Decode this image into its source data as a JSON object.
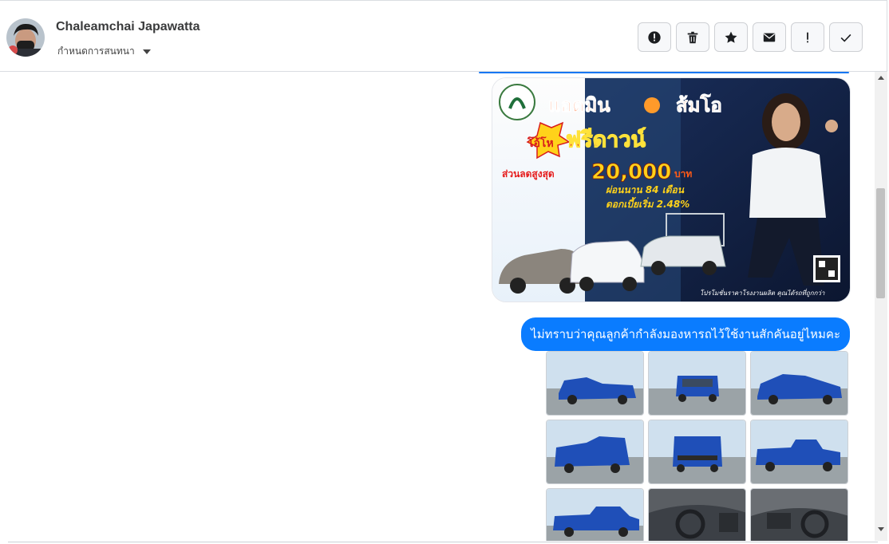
{
  "header": {
    "name": "Chaleamchai Japawatta",
    "subtitle": "กำหนดการสนทนา",
    "toolbar": [
      {
        "icon": "alert-circle-icon",
        "label": "Mark as spam"
      },
      {
        "icon": "trash-icon",
        "label": "Delete"
      },
      {
        "icon": "star-icon",
        "label": "Star"
      },
      {
        "icon": "envelope-icon",
        "label": "Mark as unread"
      },
      {
        "icon": "exclamation-icon",
        "label": "Follow up"
      },
      {
        "icon": "check-icon",
        "label": "Mark as done"
      }
    ]
  },
  "promo": {
    "headline1": "แอดมิน",
    "headline2": "ส้มโอ",
    "badge": "โอ้โห",
    "free_down": "ฟรีดาวน์",
    "discount_label": "ส่วนลดสูงสุด",
    "discount_value": "20,000",
    "discount_unit": "บาท",
    "installment": "ผ่อนนาน 84 เดือน",
    "interest": "ดอกเบี้ยเริ่ม 2.48%",
    "footer": "โปรโมชั่นราคาโรงงานผลิต คุณได้รถที่ถูกกว่า"
  },
  "message": {
    "text": "ไม่ทราบว่าคุณลูกค้ากำลังมองหารถไว้ใช้งานสักคันอยู่ไหมคะ"
  },
  "colors": {
    "accent": "#0a7cff",
    "border": "#dadde1",
    "truck_blue": "#1f4fb8"
  }
}
